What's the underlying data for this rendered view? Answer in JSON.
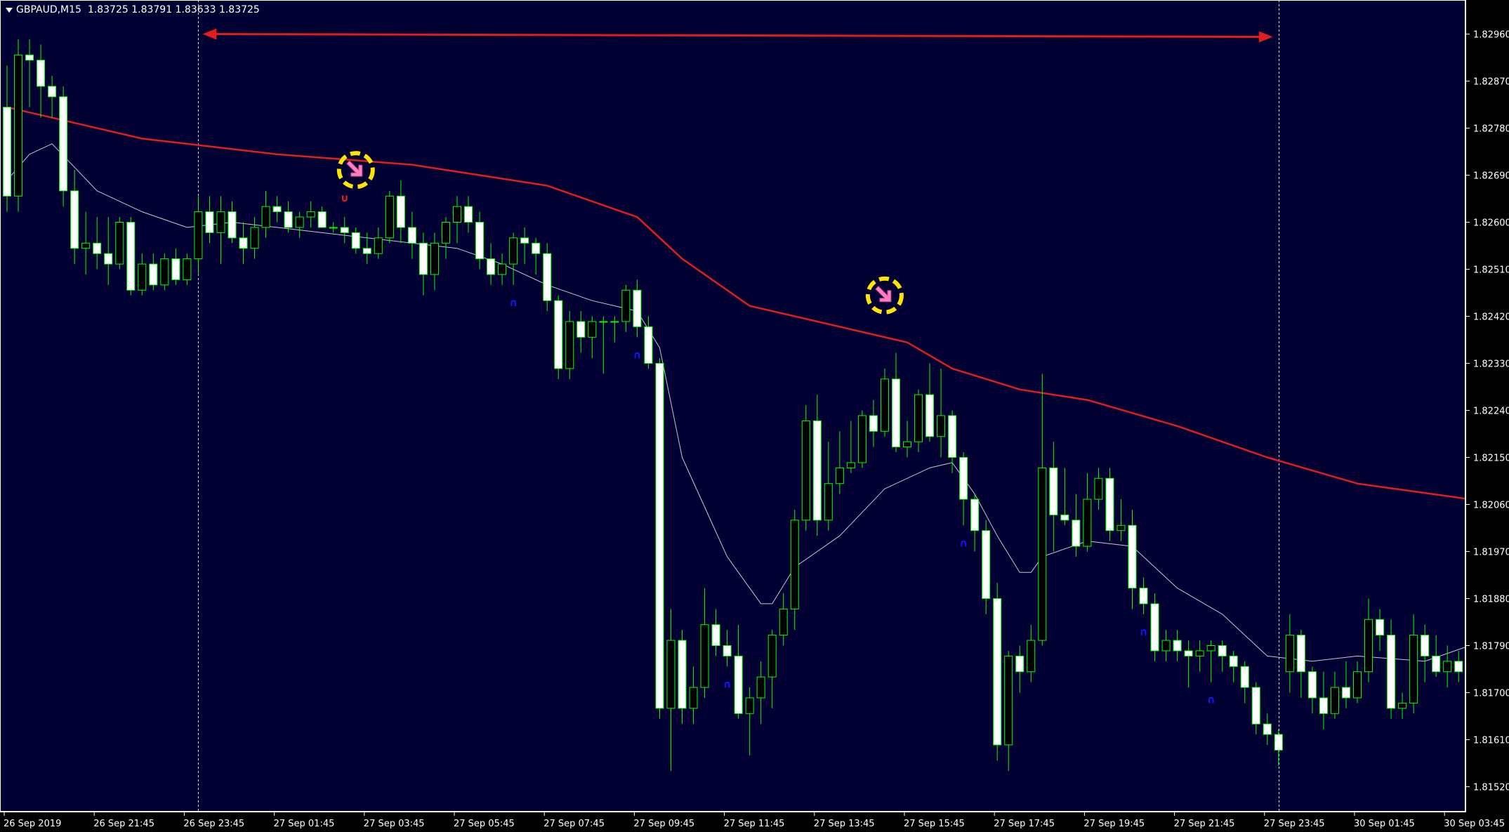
{
  "window": {
    "symbol_label": "GBPAUD,M15",
    "bid": "1.83725",
    "high": "1.83791",
    "low": "1.83633",
    "close": "1.83725"
  },
  "colors": {
    "background": "#000033",
    "bull_body": "#000000",
    "bear_body": "#ffffff",
    "candle_outline": "#00ff00",
    "ma_slow": "#e11d1d",
    "ma_fast": "#c8c8c8",
    "axis_text": "#ffffff",
    "signal_up": "#1414ff",
    "signal_down": "#ff1a1a",
    "arrow_ring": "#ffe400",
    "arrow_fill": "#ff80c0",
    "range_arrow": "#e11d1d",
    "separator": "#ffffff"
  },
  "chart_data": {
    "type": "candlestick",
    "symbol": "GBPAUD",
    "timeframe": "M15",
    "ylim": [
      1.8148,
      1.8303
    ],
    "y_ticks": [
      "1.82960",
      "1.82870",
      "1.82780",
      "1.82690",
      "1.82600",
      "1.82510",
      "1.82420",
      "1.82330",
      "1.82240",
      "1.82150",
      "1.82060",
      "1.81970",
      "1.81880",
      "1.81790",
      "1.81700",
      "1.81610",
      "1.81520"
    ],
    "x_ticks": [
      "26 Sep 2019",
      "26 Sep 21:45",
      "26 Sep 23:45",
      "27 Sep 01:45",
      "27 Sep 03:45",
      "27 Sep 05:45",
      "27 Sep 07:45",
      "27 Sep 09:45",
      "27 Sep 11:45",
      "27 Sep 13:45",
      "27 Sep 15:45",
      "27 Sep 17:45",
      "27 Sep 19:45",
      "27 Sep 21:45",
      "27 Sep 23:45",
      "30 Sep 01:45",
      "30 Sep 03:45"
    ],
    "x_tick_bar_index": [
      0,
      8,
      16,
      24,
      32,
      40,
      48,
      56,
      64,
      72,
      80,
      88,
      96,
      104,
      112,
      120,
      128
    ],
    "candles": [
      {
        "o": 1.8282,
        "h": 1.829,
        "l": 1.8262,
        "c": 1.8265
      },
      {
        "o": 1.8265,
        "h": 1.8295,
        "l": 1.8262,
        "c": 1.8292
      },
      {
        "o": 1.8292,
        "h": 1.8295,
        "l": 1.8282,
        "c": 1.8291
      },
      {
        "o": 1.8291,
        "h": 1.8294,
        "l": 1.828,
        "c": 1.8286
      },
      {
        "o": 1.8286,
        "h": 1.8288,
        "l": 1.828,
        "c": 1.8284
      },
      {
        "o": 1.8284,
        "h": 1.8286,
        "l": 1.8263,
        "c": 1.8266
      },
      {
        "o": 1.8266,
        "h": 1.827,
        "l": 1.8252,
        "c": 1.8255
      },
      {
        "o": 1.8255,
        "h": 1.8262,
        "l": 1.825,
        "c": 1.8256
      },
      {
        "o": 1.8256,
        "h": 1.8261,
        "l": 1.8251,
        "c": 1.8254
      },
      {
        "o": 1.8254,
        "h": 1.8261,
        "l": 1.8248,
        "c": 1.8252
      },
      {
        "o": 1.8252,
        "h": 1.8261,
        "l": 1.8251,
        "c": 1.826
      },
      {
        "o": 1.826,
        "h": 1.8261,
        "l": 1.8246,
        "c": 1.8247
      },
      {
        "o": 1.8247,
        "h": 1.8254,
        "l": 1.8246,
        "c": 1.8252
      },
      {
        "o": 1.8252,
        "h": 1.8254,
        "l": 1.8247,
        "c": 1.8248
      },
      {
        "o": 1.8248,
        "h": 1.8254,
        "l": 1.8247,
        "c": 1.8253
      },
      {
        "o": 1.8253,
        "h": 1.8255,
        "l": 1.8248,
        "c": 1.8249
      },
      {
        "o": 1.8249,
        "h": 1.8254,
        "l": 1.8248,
        "c": 1.8253
      },
      {
        "o": 1.8253,
        "h": 1.8265,
        "l": 1.825,
        "c": 1.8262
      },
      {
        "o": 1.8262,
        "h": 1.8265,
        "l": 1.8256,
        "c": 1.8258
      },
      {
        "o": 1.8258,
        "h": 1.8265,
        "l": 1.8252,
        "c": 1.8262
      },
      {
        "o": 1.8262,
        "h": 1.8264,
        "l": 1.8256,
        "c": 1.8257
      },
      {
        "o": 1.8257,
        "h": 1.826,
        "l": 1.8252,
        "c": 1.8255
      },
      {
        "o": 1.8255,
        "h": 1.8261,
        "l": 1.8253,
        "c": 1.8259
      },
      {
        "o": 1.8259,
        "h": 1.8266,
        "l": 1.8257,
        "c": 1.8263
      },
      {
        "o": 1.8263,
        "h": 1.8265,
        "l": 1.826,
        "c": 1.8262
      },
      {
        "o": 1.8262,
        "h": 1.8264,
        "l": 1.8258,
        "c": 1.8259
      },
      {
        "o": 1.8259,
        "h": 1.8262,
        "l": 1.8257,
        "c": 1.8261
      },
      {
        "o": 1.8261,
        "h": 1.8264,
        "l": 1.8259,
        "c": 1.8262
      },
      {
        "o": 1.8262,
        "h": 1.8263,
        "l": 1.8259,
        "c": 1.8259
      },
      {
        "o": 1.8259,
        "h": 1.826,
        "l": 1.8258,
        "c": 1.8259
      },
      {
        "o": 1.8259,
        "h": 1.8261,
        "l": 1.8256,
        "c": 1.8258
      },
      {
        "o": 1.8258,
        "h": 1.8259,
        "l": 1.8254,
        "c": 1.8255
      },
      {
        "o": 1.8255,
        "h": 1.8258,
        "l": 1.8252,
        "c": 1.8254
      },
      {
        "o": 1.8254,
        "h": 1.8259,
        "l": 1.8253,
        "c": 1.8257
      },
      {
        "o": 1.8257,
        "h": 1.8266,
        "l": 1.8256,
        "c": 1.8265
      },
      {
        "o": 1.8265,
        "h": 1.8268,
        "l": 1.8256,
        "c": 1.8259
      },
      {
        "o": 1.8259,
        "h": 1.8262,
        "l": 1.8253,
        "c": 1.8256
      },
      {
        "o": 1.8256,
        "h": 1.8258,
        "l": 1.8246,
        "c": 1.825
      },
      {
        "o": 1.825,
        "h": 1.8258,
        "l": 1.8247,
        "c": 1.8256
      },
      {
        "o": 1.8256,
        "h": 1.8261,
        "l": 1.8253,
        "c": 1.826
      },
      {
        "o": 1.826,
        "h": 1.8265,
        "l": 1.8256,
        "c": 1.8263
      },
      {
        "o": 1.8263,
        "h": 1.8265,
        "l": 1.8258,
        "c": 1.826
      },
      {
        "o": 1.826,
        "h": 1.8262,
        "l": 1.8251,
        "c": 1.8253
      },
      {
        "o": 1.8253,
        "h": 1.8256,
        "l": 1.8248,
        "c": 1.825
      },
      {
        "o": 1.825,
        "h": 1.8254,
        "l": 1.8248,
        "c": 1.8252
      },
      {
        "o": 1.8252,
        "h": 1.8258,
        "l": 1.8248,
        "c": 1.8257
      },
      {
        "o": 1.8257,
        "h": 1.8259,
        "l": 1.8252,
        "c": 1.8256
      },
      {
        "o": 1.8256,
        "h": 1.8257,
        "l": 1.825,
        "c": 1.8254
      },
      {
        "o": 1.8254,
        "h": 1.8256,
        "l": 1.8243,
        "c": 1.8245
      },
      {
        "o": 1.8245,
        "h": 1.8246,
        "l": 1.823,
        "c": 1.8232
      },
      {
        "o": 1.8232,
        "h": 1.8243,
        "l": 1.823,
        "c": 1.8241
      },
      {
        "o": 1.8241,
        "h": 1.8243,
        "l": 1.8235,
        "c": 1.8238
      },
      {
        "o": 1.8238,
        "h": 1.8242,
        "l": 1.8234,
        "c": 1.8241
      },
      {
        "o": 1.8241,
        "h": 1.8242,
        "l": 1.8231,
        "c": 1.8241
      },
      {
        "o": 1.8241,
        "h": 1.8242,
        "l": 1.8237,
        "c": 1.8241
      },
      {
        "o": 1.8241,
        "h": 1.8248,
        "l": 1.8239,
        "c": 1.8247
      },
      {
        "o": 1.8247,
        "h": 1.8249,
        "l": 1.8238,
        "c": 1.824
      },
      {
        "o": 1.824,
        "h": 1.8242,
        "l": 1.8232,
        "c": 1.8233
      },
      {
        "o": 1.8233,
        "h": 1.8234,
        "l": 1.8165,
        "c": 1.8167
      },
      {
        "o": 1.8167,
        "h": 1.8186,
        "l": 1.8155,
        "c": 1.818
      },
      {
        "o": 1.818,
        "h": 1.8182,
        "l": 1.8164,
        "c": 1.8167
      },
      {
        "o": 1.8167,
        "h": 1.8175,
        "l": 1.8164,
        "c": 1.8171
      },
      {
        "o": 1.8171,
        "h": 1.819,
        "l": 1.8169,
        "c": 1.8183
      },
      {
        "o": 1.8183,
        "h": 1.8186,
        "l": 1.8177,
        "c": 1.8179
      },
      {
        "o": 1.8179,
        "h": 1.8182,
        "l": 1.8175,
        "c": 1.8177
      },
      {
        "o": 1.8177,
        "h": 1.8183,
        "l": 1.8165,
        "c": 1.8166
      },
      {
        "o": 1.8166,
        "h": 1.8171,
        "l": 1.8158,
        "c": 1.8169
      },
      {
        "o": 1.8169,
        "h": 1.8176,
        "l": 1.8164,
        "c": 1.8173
      },
      {
        "o": 1.8173,
        "h": 1.8182,
        "l": 1.8167,
        "c": 1.8181
      },
      {
        "o": 1.8181,
        "h": 1.8189,
        "l": 1.8179,
        "c": 1.8186
      },
      {
        "o": 1.8186,
        "h": 1.8205,
        "l": 1.8182,
        "c": 1.8203
      },
      {
        "o": 1.8203,
        "h": 1.8225,
        "l": 1.8201,
        "c": 1.8222
      },
      {
        "o": 1.8222,
        "h": 1.8227,
        "l": 1.82,
        "c": 1.8203
      },
      {
        "o": 1.8203,
        "h": 1.8218,
        "l": 1.8201,
        "c": 1.821
      },
      {
        "o": 1.821,
        "h": 1.822,
        "l": 1.8208,
        "c": 1.8213
      },
      {
        "o": 1.8213,
        "h": 1.8222,
        "l": 1.8212,
        "c": 1.8214
      },
      {
        "o": 1.8214,
        "h": 1.8224,
        "l": 1.8213,
        "c": 1.8223
      },
      {
        "o": 1.8223,
        "h": 1.8226,
        "l": 1.8217,
        "c": 1.822
      },
      {
        "o": 1.822,
        "h": 1.8232,
        "l": 1.8219,
        "c": 1.823
      },
      {
        "o": 1.823,
        "h": 1.8235,
        "l": 1.8216,
        "c": 1.8217
      },
      {
        "o": 1.8217,
        "h": 1.8222,
        "l": 1.8215,
        "c": 1.8218
      },
      {
        "o": 1.8218,
        "h": 1.8228,
        "l": 1.8216,
        "c": 1.8227
      },
      {
        "o": 1.8227,
        "h": 1.8233,
        "l": 1.8218,
        "c": 1.8219
      },
      {
        "o": 1.8219,
        "h": 1.8232,
        "l": 1.8215,
        "c": 1.8223
      },
      {
        "o": 1.8223,
        "h": 1.8224,
        "l": 1.8212,
        "c": 1.8215
      },
      {
        "o": 1.8215,
        "h": 1.8216,
        "l": 1.8202,
        "c": 1.8207
      },
      {
        "o": 1.8207,
        "h": 1.8208,
        "l": 1.8197,
        "c": 1.8201
      },
      {
        "o": 1.8201,
        "h": 1.8203,
        "l": 1.8185,
        "c": 1.8188
      },
      {
        "o": 1.8188,
        "h": 1.8191,
        "l": 1.8157,
        "c": 1.816
      },
      {
        "o": 1.816,
        "h": 1.8178,
        "l": 1.8155,
        "c": 1.8177
      },
      {
        "o": 1.8177,
        "h": 1.8179,
        "l": 1.817,
        "c": 1.8174
      },
      {
        "o": 1.8174,
        "h": 1.8183,
        "l": 1.8172,
        "c": 1.818
      },
      {
        "o": 1.818,
        "h": 1.8231,
        "l": 1.8179,
        "c": 1.8213
      },
      {
        "o": 1.8213,
        "h": 1.8218,
        "l": 1.8197,
        "c": 1.8204
      },
      {
        "o": 1.8204,
        "h": 1.8213,
        "l": 1.8202,
        "c": 1.8203
      },
      {
        "o": 1.8203,
        "h": 1.8208,
        "l": 1.8196,
        "c": 1.8198
      },
      {
        "o": 1.8198,
        "h": 1.8212,
        "l": 1.8197,
        "c": 1.8207
      },
      {
        "o": 1.8207,
        "h": 1.8213,
        "l": 1.8205,
        "c": 1.8211
      },
      {
        "o": 1.8211,
        "h": 1.8213,
        "l": 1.8199,
        "c": 1.8201
      },
      {
        "o": 1.8201,
        "h": 1.8207,
        "l": 1.8199,
        "c": 1.8202
      },
      {
        "o": 1.8202,
        "h": 1.8205,
        "l": 1.8186,
        "c": 1.819
      },
      {
        "o": 1.819,
        "h": 1.8192,
        "l": 1.8185,
        "c": 1.8187
      },
      {
        "o": 1.8187,
        "h": 1.8189,
        "l": 1.8176,
        "c": 1.8178
      },
      {
        "o": 1.8178,
        "h": 1.8182,
        "l": 1.8176,
        "c": 1.818
      },
      {
        "o": 1.818,
        "h": 1.8182,
        "l": 1.8176,
        "c": 1.8178
      },
      {
        "o": 1.8178,
        "h": 1.818,
        "l": 1.8171,
        "c": 1.8177
      },
      {
        "o": 1.8177,
        "h": 1.818,
        "l": 1.8174,
        "c": 1.8178
      },
      {
        "o": 1.8178,
        "h": 1.818,
        "l": 1.8172,
        "c": 1.8179
      },
      {
        "o": 1.8179,
        "h": 1.818,
        "l": 1.8174,
        "c": 1.8177
      },
      {
        "o": 1.8177,
        "h": 1.8178,
        "l": 1.8172,
        "c": 1.8175
      },
      {
        "o": 1.8175,
        "h": 1.8176,
        "l": 1.8168,
        "c": 1.8171
      },
      {
        "o": 1.8171,
        "h": 1.8172,
        "l": 1.8162,
        "c": 1.8164
      },
      {
        "o": 1.8164,
        "h": 1.8166,
        "l": 1.816,
        "c": 1.8162
      },
      {
        "o": 1.8162,
        "h": 1.8163,
        "l": 1.8156,
        "c": 1.8159
      },
      {
        "o": 1.8174,
        "h": 1.8185,
        "l": 1.817,
        "c": 1.8181
      },
      {
        "o": 1.8181,
        "h": 1.8182,
        "l": 1.8169,
        "c": 1.8174
      },
      {
        "o": 1.8174,
        "h": 1.8175,
        "l": 1.8166,
        "c": 1.8169
      },
      {
        "o": 1.8169,
        "h": 1.8174,
        "l": 1.8163,
        "c": 1.8166
      },
      {
        "o": 1.8166,
        "h": 1.8174,
        "l": 1.8165,
        "c": 1.8171
      },
      {
        "o": 1.8171,
        "h": 1.8176,
        "l": 1.8167,
        "c": 1.8169
      },
      {
        "o": 1.8169,
        "h": 1.8176,
        "l": 1.8168,
        "c": 1.8174
      },
      {
        "o": 1.8174,
        "h": 1.8188,
        "l": 1.8172,
        "c": 1.8184
      },
      {
        "o": 1.8184,
        "h": 1.8186,
        "l": 1.8178,
        "c": 1.8181
      },
      {
        "o": 1.8181,
        "h": 1.8184,
        "l": 1.8165,
        "c": 1.8167
      },
      {
        "o": 1.8167,
        "h": 1.817,
        "l": 1.8165,
        "c": 1.8168
      },
      {
        "o": 1.8168,
        "h": 1.8185,
        "l": 1.8166,
        "c": 1.8181
      },
      {
        "o": 1.8181,
        "h": 1.8183,
        "l": 1.8172,
        "c": 1.8177
      },
      {
        "o": 1.8177,
        "h": 1.8181,
        "l": 1.8173,
        "c": 1.8174
      },
      {
        "o": 1.8174,
        "h": 1.8179,
        "l": 1.8171,
        "c": 1.8176
      },
      {
        "o": 1.8176,
        "h": 1.8178,
        "l": 1.8172,
        "c": 1.8174
      },
      {
        "o": 1.8174,
        "h": 1.8178,
        "l": 1.8172,
        "c": 1.8176
      },
      {
        "o": 1.8176,
        "h": 1.8191,
        "l": 1.8175,
        "c": 1.8185
      },
      {
        "o": 1.8185,
        "h": 1.8189,
        "l": 1.818,
        "c": 1.8182
      },
      {
        "o": 1.8182,
        "h": 1.8195,
        "l": 1.818,
        "c": 1.8183
      }
    ],
    "series": [
      {
        "type": "line",
        "role": "slow_ma",
        "points": [
          [
            0,
            1.8282
          ],
          [
            12,
            1.8276
          ],
          [
            24,
            1.8273
          ],
          [
            36,
            1.8271
          ],
          [
            48,
            1.8267
          ],
          [
            56,
            1.8261
          ],
          [
            60,
            1.8253
          ],
          [
            64,
            1.8247
          ],
          [
            66,
            1.8244
          ],
          [
            72,
            1.8241
          ],
          [
            80,
            1.8237
          ],
          [
            84,
            1.8232
          ],
          [
            90,
            1.8228
          ],
          [
            96,
            1.8226
          ],
          [
            104,
            1.8221
          ],
          [
            112,
            1.8215
          ],
          [
            120,
            1.821
          ],
          [
            130,
            1.8207
          ]
        ]
      },
      {
        "type": "line",
        "role": "fast_ma",
        "points": [
          [
            0,
            1.8268
          ],
          [
            2,
            1.8273
          ],
          [
            4,
            1.8275
          ],
          [
            8,
            1.8266
          ],
          [
            12,
            1.8262
          ],
          [
            16,
            1.8259
          ],
          [
            20,
            1.826
          ],
          [
            24,
            1.8259
          ],
          [
            28,
            1.8258
          ],
          [
            32,
            1.8257
          ],
          [
            36,
            1.8256
          ],
          [
            40,
            1.8255
          ],
          [
            44,
            1.8252
          ],
          [
            48,
            1.8248
          ],
          [
            52,
            1.8245
          ],
          [
            56,
            1.8243
          ],
          [
            58,
            1.8236
          ],
          [
            60,
            1.8215
          ],
          [
            64,
            1.8196
          ],
          [
            67,
            1.8187
          ],
          [
            68,
            1.8187
          ],
          [
            70,
            1.8194
          ],
          [
            74,
            1.82
          ],
          [
            78,
            1.8209
          ],
          [
            82,
            1.8213
          ],
          [
            84,
            1.8214
          ],
          [
            86,
            1.8208
          ],
          [
            88,
            1.82
          ],
          [
            90,
            1.8193
          ],
          [
            91,
            1.8193
          ],
          [
            92,
            1.8196
          ],
          [
            96,
            1.8199
          ],
          [
            100,
            1.8198
          ],
          [
            104,
            1.819
          ],
          [
            108,
            1.8185
          ],
          [
            112,
            1.8177
          ],
          [
            116,
            1.8176
          ],
          [
            120,
            1.8177
          ],
          [
            126,
            1.8176
          ],
          [
            130,
            1.8179
          ]
        ]
      }
    ],
    "signals_up": [
      45,
      56,
      64,
      85,
      101,
      107
    ],
    "signals_down": [
      30
    ],
    "sell_arrows": [
      {
        "bar": 31,
        "price": 1.827
      },
      {
        "bar": 78,
        "price": 1.8246
      }
    ],
    "range_arrow": {
      "from_bar": 18,
      "to_bar": 113,
      "price": 1.8296
    },
    "separators": [
      17,
      113
    ]
  }
}
